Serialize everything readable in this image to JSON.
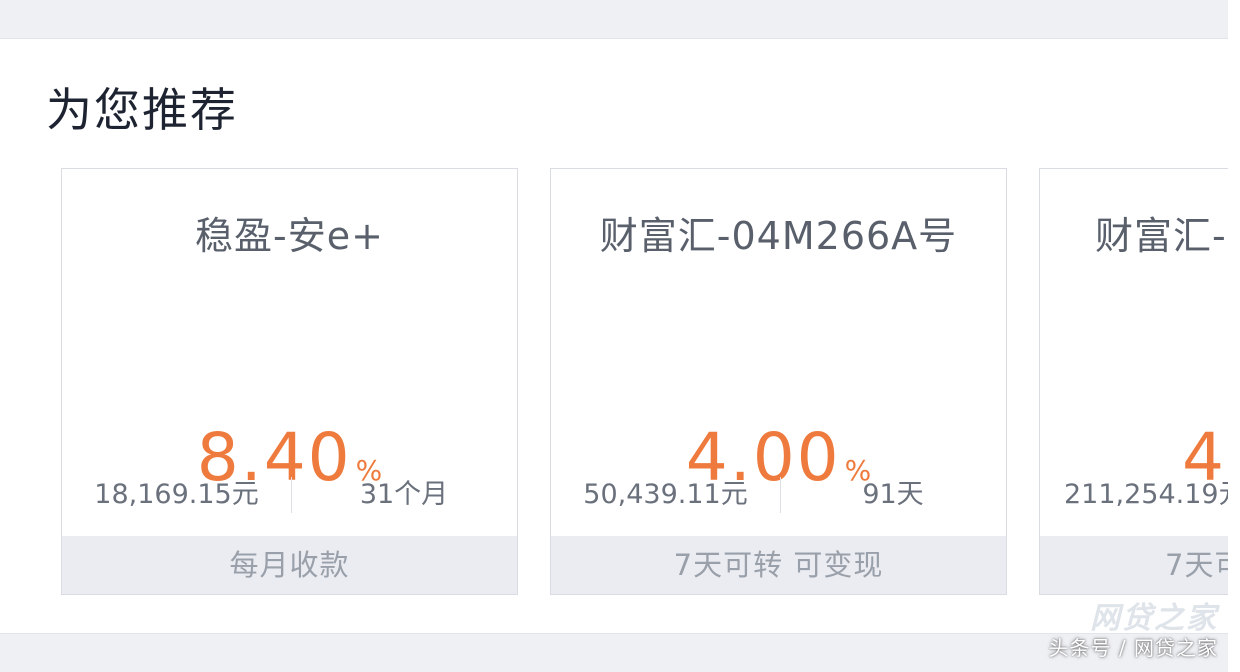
{
  "section": {
    "title": "为您推荐"
  },
  "cards": [
    {
      "name": "稳盈-安e+",
      "rate": "8.40",
      "rate_unit": "%",
      "amount": "18,169.15元",
      "term": "31个月",
      "footer": "每月收款"
    },
    {
      "name": "财富汇-04M266A号",
      "rate": "4.00",
      "rate_unit": "%",
      "amount": "50,439.11元",
      "term": "91天",
      "footer": "7天可转 可变现"
    },
    {
      "name": "财富汇-",
      "rate": "4",
      "amount": "211,254.19元",
      "footer": "7天可"
    }
  ],
  "watermark": {
    "logo": "网贷之家",
    "text": "头条号 / 网贷之家"
  },
  "colors": {
    "accent": "#ee7b3d",
    "title": "#1d2330",
    "footer_bg": "#eaecf1"
  }
}
